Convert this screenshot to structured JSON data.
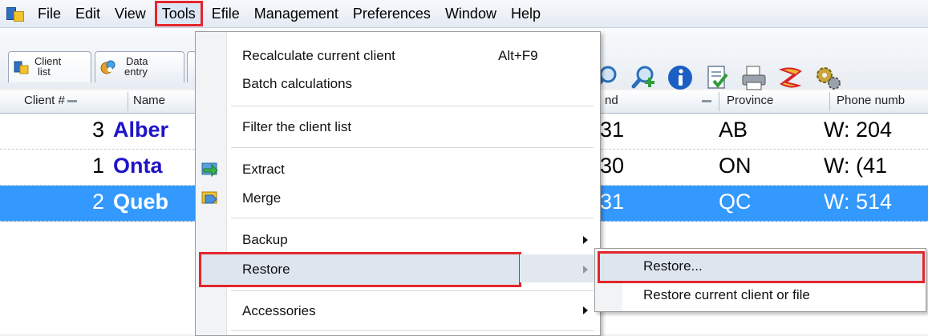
{
  "menubar": {
    "items": [
      "File",
      "Edit",
      "View",
      "Tools",
      "Efile",
      "Management",
      "Preferences",
      "Window",
      "Help"
    ]
  },
  "tabs": [
    {
      "line1": "Client",
      "line2": "list"
    },
    {
      "line1": "Data",
      "line2": "entry"
    }
  ],
  "toolbar_icons": [
    "search-icon",
    "find-client-icon",
    "info-icon",
    "checklist-icon",
    "print-icon",
    "efile-icon",
    "settings-icon"
  ],
  "columns": {
    "client_num": "Client #",
    "name": "Name",
    "year_end": "nd",
    "province": "Province",
    "phone": "Phone numb"
  },
  "rows": [
    {
      "num": "3",
      "name": "Alber",
      "year_end": "31",
      "province": "AB",
      "phone": "W: 204",
      "selected": false
    },
    {
      "num": "1",
      "name": "Onta",
      "year_end": "30",
      "province": "ON",
      "phone": "W: (41",
      "selected": false
    },
    {
      "num": "2",
      "name": "Queb",
      "year_end": "31",
      "province": "QC",
      "phone": "W: 514",
      "selected": true
    }
  ],
  "tools_menu": {
    "recalculate": "Recalculate current client",
    "recalculate_shortcut": "Alt+F9",
    "batch": "Batch calculations",
    "filter": "Filter the client list",
    "extract": "Extract",
    "merge": "Merge",
    "backup": "Backup",
    "restore": "Restore",
    "accessories": "Accessories"
  },
  "restore_submenu": {
    "restore": "Restore...",
    "restore_current": "Restore current client or file"
  },
  "colors": {
    "highlight_border": "#e3262c",
    "selection": "#3399ff",
    "client_name": "#1f14c8"
  }
}
